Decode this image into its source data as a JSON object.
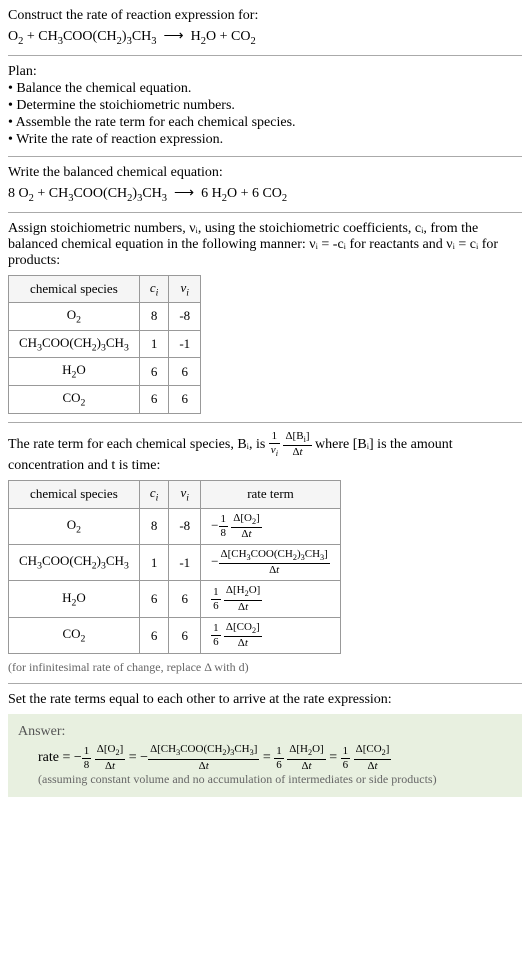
{
  "header": {
    "prompt": "Construct the rate of reaction expression for:",
    "equation_reactants": "O₂ + CH₃COO(CH₂)₃CH₃",
    "equation_arrow": "⟶",
    "equation_products": "H₂O + CO₂"
  },
  "plan": {
    "title": "Plan:",
    "items": [
      "Balance the chemical equation.",
      "Determine the stoichiometric numbers.",
      "Assemble the rate term for each chemical species.",
      "Write the rate of reaction expression."
    ]
  },
  "balanced": {
    "title": "Write the balanced chemical equation:",
    "equation": "8 O₂ + CH₃COO(CH₂)₃CH₃  ⟶  6 H₂O + 6 CO₂"
  },
  "stoich": {
    "intro_a": "Assign stoichiometric numbers, νᵢ, using the stoichiometric coefficients, cᵢ, from the balanced chemical equation in the following manner: νᵢ = -cᵢ for reactants and νᵢ = cᵢ for products:",
    "headers": [
      "chemical species",
      "cᵢ",
      "νᵢ"
    ],
    "rows": [
      {
        "species": "O₂",
        "c": "8",
        "v": "-8"
      },
      {
        "species": "CH₃COO(CH₂)₃CH₃",
        "c": "1",
        "v": "-1"
      },
      {
        "species": "H₂O",
        "c": "6",
        "v": "6"
      },
      {
        "species": "CO₂",
        "c": "6",
        "v": "6"
      }
    ]
  },
  "rateterm": {
    "intro_a": "The rate term for each chemical species, Bᵢ, is ",
    "intro_b": " where [Bᵢ] is the amount concentration and t is time:",
    "headers": [
      "chemical species",
      "cᵢ",
      "νᵢ",
      "rate term"
    ],
    "rows": [
      {
        "species": "O₂",
        "c": "8",
        "v": "-8",
        "num_a": "1",
        "den_a": "8",
        "num_b": "Δ[O₂]",
        "den_b": "Δt",
        "sign": "−"
      },
      {
        "species": "CH₃COO(CH₂)₃CH₃",
        "c": "1",
        "v": "-1",
        "num_a": "",
        "den_a": "",
        "num_b": "Δ[CH₃COO(CH₂)₃CH₃]",
        "den_b": "Δt",
        "sign": "−"
      },
      {
        "species": "H₂O",
        "c": "6",
        "v": "6",
        "num_a": "1",
        "den_a": "6",
        "num_b": "Δ[H₂O]",
        "den_b": "Δt",
        "sign": ""
      },
      {
        "species": "CO₂",
        "c": "6",
        "v": "6",
        "num_a": "1",
        "den_a": "6",
        "num_b": "Δ[CO₂]",
        "den_b": "Δt",
        "sign": ""
      }
    ],
    "note": "(for infinitesimal rate of change, replace Δ with d)"
  },
  "final": {
    "intro": "Set the rate terms equal to each other to arrive at the rate expression:",
    "answer_label": "Answer:",
    "note": "(assuming constant volume and no accumulation of intermediates or side products)"
  },
  "chart_data": {
    "type": "table",
    "tables": [
      {
        "title": "stoichiometric numbers",
        "columns": [
          "chemical species",
          "c_i",
          "ν_i"
        ],
        "rows": [
          [
            "O2",
            8,
            -8
          ],
          [
            "CH3COO(CH2)3CH3",
            1,
            -1
          ],
          [
            "H2O",
            6,
            6
          ],
          [
            "CO2",
            6,
            6
          ]
        ]
      },
      {
        "title": "rate terms",
        "columns": [
          "chemical species",
          "c_i",
          "ν_i",
          "rate term"
        ],
        "rows": [
          [
            "O2",
            8,
            -8,
            "-(1/8) d[O2]/dt"
          ],
          [
            "CH3COO(CH2)3CH3",
            1,
            -1,
            "-d[CH3COO(CH2)3CH3]/dt"
          ],
          [
            "H2O",
            6,
            6,
            "(1/6) d[H2O]/dt"
          ],
          [
            "CO2",
            6,
            6,
            "(1/6) d[CO2]/dt"
          ]
        ]
      }
    ],
    "rate_expression": "rate = -(1/8) d[O2]/dt = -d[CH3COO(CH2)3CH3]/dt = (1/6) d[H2O]/dt = (1/6) d[CO2]/dt"
  }
}
